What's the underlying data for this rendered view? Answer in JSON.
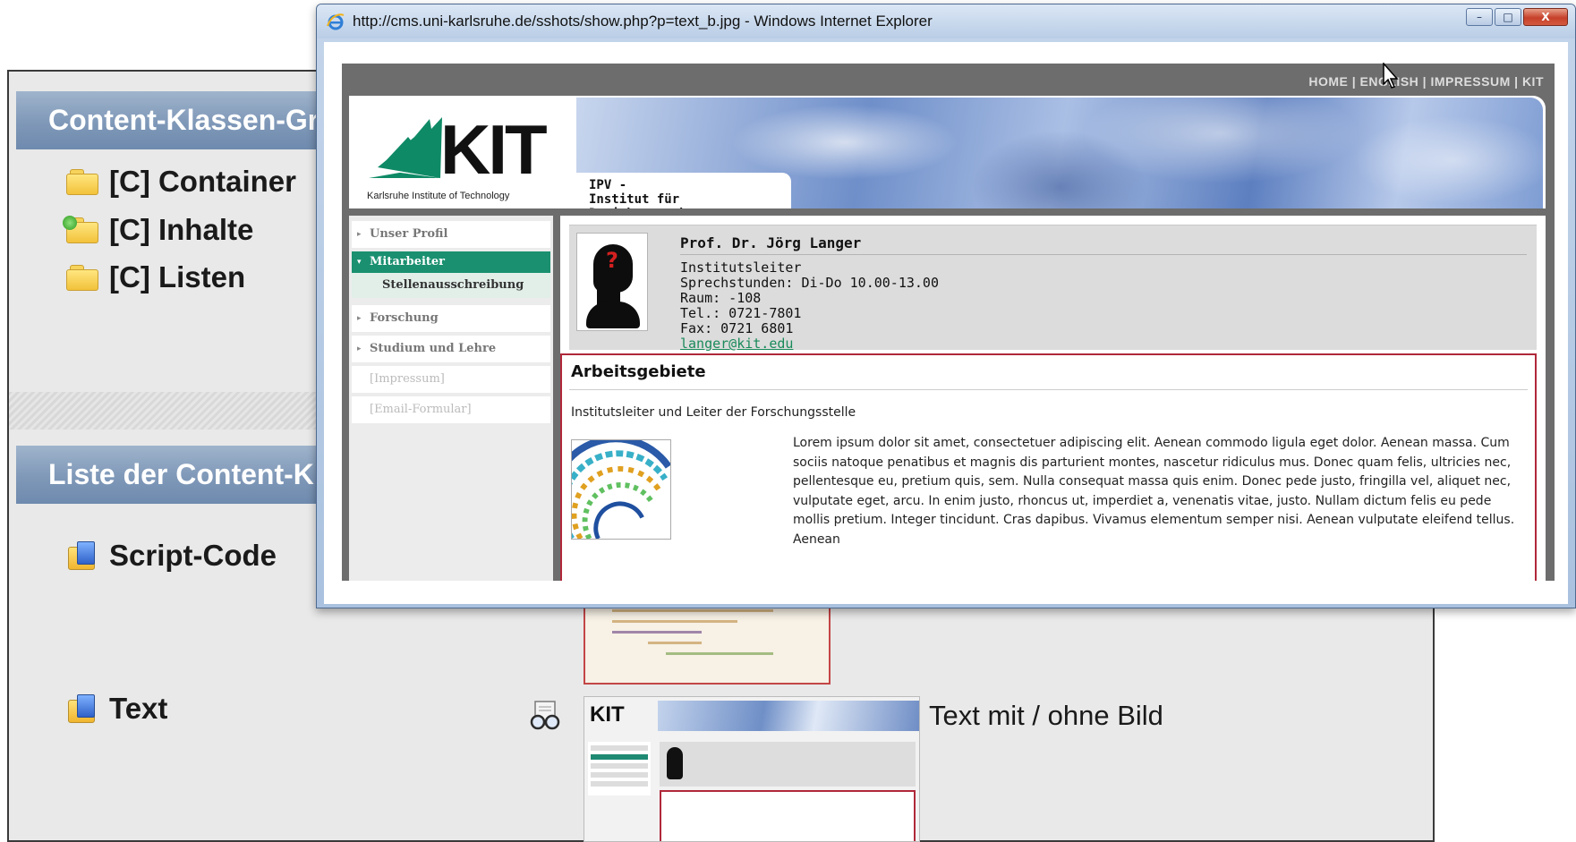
{
  "cms": {
    "group_header": "Content-Klassen-Gru",
    "groups": [
      {
        "label": "[C] Container",
        "icon": "folder-icon"
      },
      {
        "label": "[C] Inhalte",
        "icon": "folder-refresh-icon"
      },
      {
        "label": "[C] Listen",
        "icon": "folder-icon"
      }
    ],
    "list_header": "Liste der Content-Kla",
    "classes": [
      {
        "label": "Script-Code",
        "icon": "content-class-icon"
      },
      {
        "label": "Text",
        "icon": "content-class-icon"
      }
    ],
    "text_caption": "Text mit / ohne Bild"
  },
  "browser": {
    "title": "http://cms.uni-karlsruhe.de/sshots/show.php?p=text_b.jpg - Windows Internet Explorer",
    "buttons": {
      "minimize": "–",
      "maximize": "□",
      "close": "X"
    }
  },
  "kit_page": {
    "top_nav": "HOME | ENGLISH | IMPRESSUM | KIT",
    "logo_text": "KIT",
    "logo_subtitle": "Karlsruhe Institute of Technology",
    "institute_line1": "IPV -",
    "institute_line2": "Institut für Projektvorgaben",
    "nav": [
      {
        "label": "Unser Profil"
      },
      {
        "label": "Mitarbeiter"
      },
      {
        "label": "Stellenausschreibung"
      },
      {
        "label": "Forschung"
      },
      {
        "label": "Studium und Lehre"
      },
      {
        "label": "[Impressum]"
      },
      {
        "label": "[Email-Formular]"
      }
    ],
    "person": {
      "name": "Prof. Dr. Jörg Langer",
      "role": "Institutsleiter",
      "hours": "Sprechstunden: Di-Do 10.00-13.00",
      "room": "Raum: -108",
      "phone": "Tel.: 0721-7801",
      "fax": "Fax: 0721 6801",
      "email": "langer@kit.edu"
    },
    "section": {
      "title": "Arbeitsgebiete",
      "intro": "Institutsleiter und Leiter der Forschungsstelle",
      "body": "Lorem ipsum dolor sit amet, consectetuer adipiscing elit. Aenean commodo ligula eget dolor. Aenean massa. Cum sociis natoque penatibus et magnis dis parturient montes, nascetur ridiculus mus. Donec quam felis, ultricies nec, pellentesque eu, pretium quis, sem. Nulla consequat massa quis enim. Donec pede justo, fringilla vel, aliquet nec, vulputate eget, arcu. In enim justo, rhoncus ut, imperdiet a, venenatis vitae, justo. Nullam dictum felis eu pede mollis pretium. Integer tincidunt. Cras dapibus. Vivamus elementum semper nisi. Aenean vulputate eleifend tellus. Aenean"
    }
  },
  "thumbnail_logo": "KIT",
  "colors": {
    "header_blue": "#7f98b8",
    "kit_green": "#1a9070",
    "highlight_red": "#b0283a",
    "close_red": "#c6402a"
  }
}
